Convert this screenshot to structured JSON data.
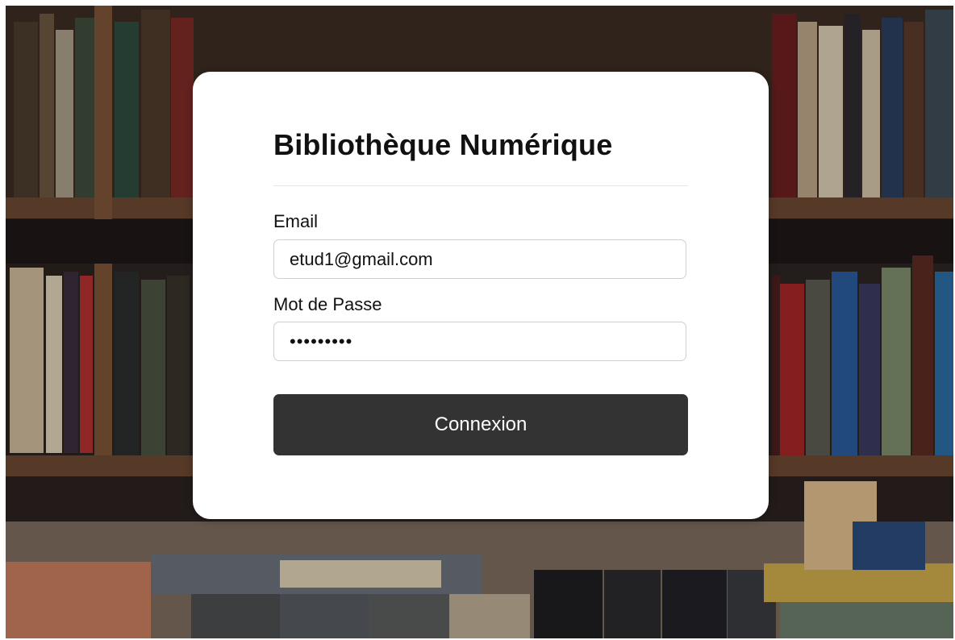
{
  "login": {
    "title": "Bibliothèque Numérique",
    "email_label": "Email",
    "email_value": "etud1@gmail.com",
    "password_label": "Mot de Passe",
    "password_value": "*********",
    "submit_label": "Connexion"
  },
  "colors": {
    "card": "#ffffff",
    "button": "#333333",
    "button_text": "#ffffff",
    "input_border": "#cfcfcf"
  }
}
